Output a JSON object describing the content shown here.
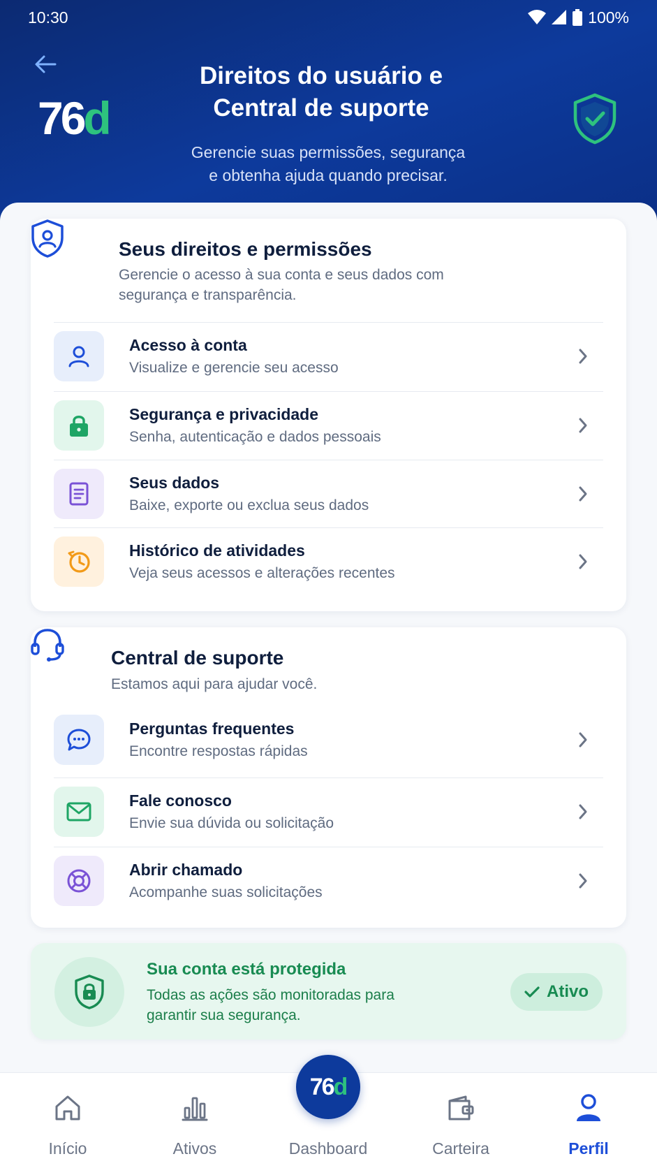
{
  "status": {
    "time": "10:30",
    "battery": "100%"
  },
  "header": {
    "logo_num": "76",
    "logo_d": "d",
    "title_line1": "Direitos do usuário e",
    "title_line2": "Central de suporte",
    "subtitle_line1": "Gerencie suas permissões, segurança",
    "subtitle_line2": "e obtenha ajuda quando precisar."
  },
  "rights": {
    "title": "Seus direitos e permissões",
    "desc": "Gerencie o acesso à sua conta e seus dados com segurança e transparência.",
    "items": [
      {
        "title": "Acesso à conta",
        "sub": "Visualize e gerencie seu acesso",
        "icon": "user-icon"
      },
      {
        "title": "Segurança e privacidade",
        "sub": "Senha, autenticação e dados pessoais",
        "icon": "lock-icon"
      },
      {
        "title": "Seus dados",
        "sub": "Baixe, exporte ou exclua seus dados",
        "icon": "document-icon"
      },
      {
        "title": "Histórico de atividades",
        "sub": "Veja seus acessos e alterações recentes",
        "icon": "history-icon"
      }
    ]
  },
  "support": {
    "title": "Central de suporte",
    "desc": "Estamos aqui para ajudar você.",
    "items": [
      {
        "title": "Perguntas frequentes",
        "sub": "Encontre respostas rápidas",
        "icon": "chat-icon"
      },
      {
        "title": "Fale conosco",
        "sub": "Envie sua dúvida ou solicitação",
        "icon": "mail-icon"
      },
      {
        "title": "Abrir chamado",
        "sub": "Acompanhe suas solicitações",
        "icon": "lifebuoy-icon"
      }
    ]
  },
  "protection": {
    "title": "Sua conta está protegida",
    "desc": "Todas as ações são monitoradas para garantir sua segurança.",
    "badge": "Ativo"
  },
  "tabs": {
    "home": "Início",
    "assets": "Ativos",
    "dashboard": "Dashboard",
    "wallet": "Carteira",
    "profile": "Perfil",
    "fab_num": "76",
    "fab_d": "d"
  },
  "colors": {
    "header": "#0d3a9c",
    "accent_green": "#2ec27e",
    "active_tab": "#1d4ed8"
  }
}
